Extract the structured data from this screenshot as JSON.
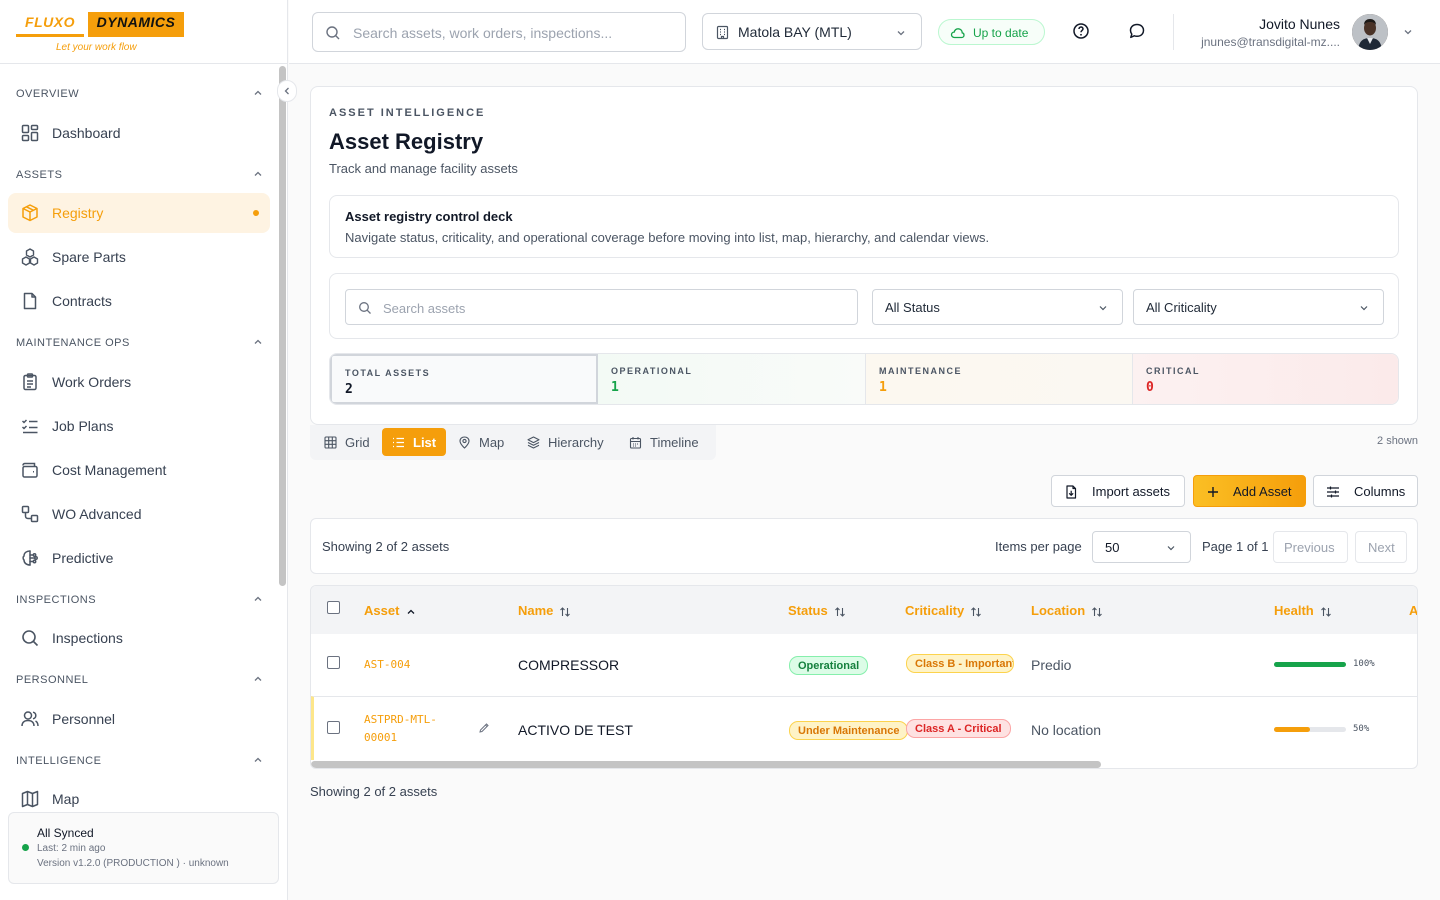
{
  "brand": {
    "left": "FLUXO",
    "right": "DYNAMICS",
    "tagline": "Let your work flow",
    "accent": "#f59e0b"
  },
  "sidebar": {
    "sections": [
      {
        "title": "OVERVIEW",
        "items": [
          {
            "label": "Dashboard",
            "icon": "dashboard-icon"
          }
        ]
      },
      {
        "title": "ASSETS",
        "items": [
          {
            "label": "Registry",
            "icon": "box-icon",
            "active": true
          },
          {
            "label": "Spare Parts",
            "icon": "boxes-icon"
          },
          {
            "label": "Contracts",
            "icon": "file-icon"
          }
        ]
      },
      {
        "title": "MAINTENANCE OPS",
        "items": [
          {
            "label": "Work Orders",
            "icon": "clipboard-icon"
          },
          {
            "label": "Job Plans",
            "icon": "checklist-icon"
          },
          {
            "label": "Cost Management",
            "icon": "wallet-icon"
          },
          {
            "label": "WO Advanced",
            "icon": "workflow-icon"
          },
          {
            "label": "Predictive",
            "icon": "brain-icon"
          }
        ]
      },
      {
        "title": "INSPECTIONS",
        "items": [
          {
            "label": "Inspections",
            "icon": "search-icon"
          }
        ]
      },
      {
        "title": "PERSONNEL",
        "items": [
          {
            "label": "Personnel",
            "icon": "users-icon"
          }
        ]
      },
      {
        "title": "INTELLIGENCE",
        "items": [
          {
            "label": "Map",
            "icon": "map-icon"
          }
        ]
      }
    ],
    "sync": {
      "title": "All Synced",
      "last": "Last: 2 min ago",
      "version": "Version v1.2.0 (PRODUCTION ) · unknown"
    }
  },
  "topbar": {
    "search_placeholder": "Search assets, work orders, inspections...",
    "site": "Matola BAY (MTL)",
    "status": "Up to date",
    "user_name": "Jovito Nunes",
    "user_email": "jnunes@transdigital-mz...."
  },
  "header": {
    "eyebrow": "ASSET INTELLIGENCE",
    "title": "Asset Registry",
    "subtitle": "Track and manage facility assets",
    "deck_title": "Asset registry control deck",
    "deck_desc": "Navigate status, criticality, and operational coverage before moving into list, map, hierarchy, and calendar views."
  },
  "filters": {
    "search_placeholder": "Search assets",
    "status": "All Status",
    "criticality": "All Criticality"
  },
  "stats": [
    {
      "label": "TOTAL ASSETS",
      "value": "2",
      "color": "#111827"
    },
    {
      "label": "OPERATIONAL",
      "value": "1",
      "color": "#16a34a"
    },
    {
      "label": "MAINTENANCE",
      "value": "1",
      "color": "#f59e0b"
    },
    {
      "label": "CRITICAL",
      "value": "0",
      "color": "#dc2626"
    }
  ],
  "views": {
    "tabs": [
      "Grid",
      "List",
      "Map",
      "Hierarchy",
      "Timeline"
    ],
    "active": "List",
    "shown": "2 shown"
  },
  "actions": {
    "import": "Import assets",
    "add": "Add Asset",
    "columns": "Columns"
  },
  "pager": {
    "showing": "Showing 2 of 2 assets",
    "items_per_page_label": "Items per page",
    "items_per_page": "50",
    "page": "Page 1 of 1",
    "prev": "Previous",
    "next": "Next"
  },
  "table": {
    "columns": [
      "Asset",
      "Name",
      "Status",
      "Criticality",
      "Location",
      "Health",
      "A"
    ],
    "rows": [
      {
        "code": "AST-004",
        "name": "COMPRESSOR",
        "status": "Operational",
        "criticality": "Class B - Important",
        "location": "Predio",
        "health": 100,
        "health_label": "100%"
      },
      {
        "code_line1": "ASTPRD-MTL-",
        "code_line2": "00001",
        "name": "ACTIVO DE TEST",
        "status": "Under Maintenance",
        "criticality": "Class A - Critical",
        "location": "No location",
        "health": 50,
        "health_label": "50%"
      }
    ]
  },
  "footer": {
    "showing": "Showing 2 of 2 assets"
  }
}
